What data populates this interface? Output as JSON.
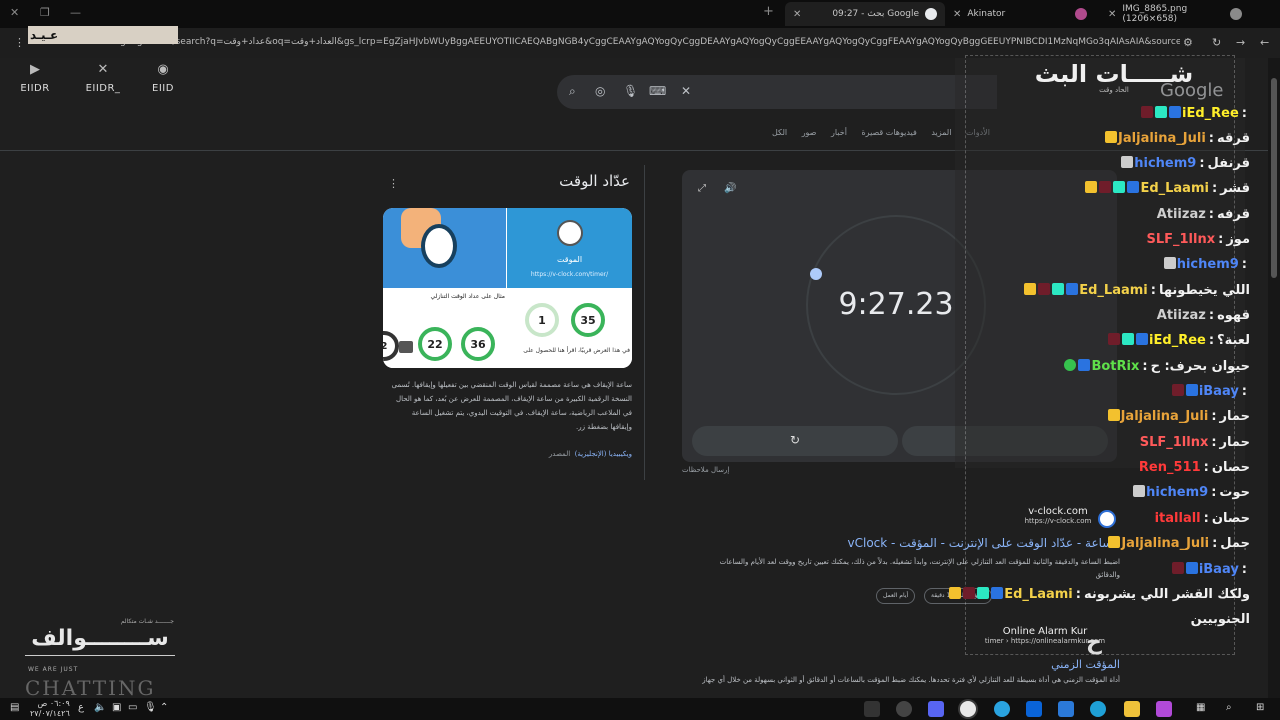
{
  "browser": {
    "tabs": [
      {
        "label": "IMG_8865.png (1206×658)",
        "fav_color": "#8a8a8a",
        "active": false
      },
      {
        "label": "Akinator",
        "fav_color": "#b04a8c",
        "active": false
      },
      {
        "label": "09:27 - بحث Google",
        "fav_color": "#e8eaed",
        "active": true
      }
    ],
    "new_tab": "+",
    "url": "google.com/search?q=عداد+وقت&oq=العداد+وقت&gs_lcrp=EgZjaHJvbWUyBggAEEUYOTIICAEQABgNGB4yCggCEAAYgAQYogQyCggDEAAYgAQYogQyCggEEAAYgAQYogQyCggFEAAYgAQYogQyBggGEEUYPNIBCDI1MzNqMGo3qAIAsAIA&sourceid=chrome"
  },
  "overlay_top_left_logo": "عـيـد",
  "socials": [
    {
      "icon": "youtube-icon",
      "glyph": "▶",
      "label": "EIIDR"
    },
    {
      "icon": "x-icon",
      "glyph": "✕",
      "label": "EIIDR_"
    },
    {
      "icon": "discord-icon",
      "glyph": "◉",
      "label": "EIID"
    }
  ],
  "google": {
    "logo": "Google",
    "nav_tabs": [
      "الأدوات",
      "المزيد",
      "فيديوهات قصيرة",
      "أخبار",
      "صور",
      "الكل"
    ]
  },
  "knowledge_panel": {
    "title": "عدّاد الوقت",
    "image_card_right": {
      "title": "الموقت",
      "url": "https://v-clock.com/timer/"
    },
    "image_card_article": "مثال على عداد الوقت التنازلي",
    "image_card_caption": "في هذا العرض قريبًا، اقرأ هنا للحصول على",
    "rings": [
      "35",
      "1",
      "36",
      "22",
      "2"
    ],
    "description": "ساعة الإيقاف هي ساعة مصممة لقياس الوقت المنقضي بين تفعيلها وإيقافها. تُسمى النسخة الرقمية الكبيرة من ساعة الإيقاف، المصممة للعرض عن بُعد، كما هو الحال في الملاعب الرياضية، ساعة الإيقاف. في التوقيت اليدوي، يتم تشغيل الساعة وإيقافها بضغطة زر.",
    "source_label": "المصدر",
    "source_link": "ويكيبيديا (الإنجليزية)"
  },
  "timer": {
    "display": "9:27.23",
    "reset_label": "↻",
    "feedback": "إرسال ملاحظات"
  },
  "results": [
    {
      "title": "vClock - الساعة - عدّاد الوقت على الإنترنت - المؤقت",
      "snippet": "اضبط الساعة والدقيقة والثانية للمؤقت العد التنازلي على الإنترنت، وابدأ تشغيله. بدلاً من ذلك، يمكنك تعيين تاريخ ووقت لعد الأيام والساعات والدقائق",
      "chips": [
        "أيام العمل",
        "المؤقت لمدة 1 دقيقة"
      ]
    },
    {
      "title": "المؤقت الزمني",
      "snippet": "أداة المؤقت الزمني هي أداة بسيطة للعد التنازلي لأي فترة تحددها. يمكنك ضبط المؤقت بالساعات أو الدقائق أو الثواني بسهولة من خلال أي جهاز"
    }
  ],
  "chat": {
    "title": "شـــــات البث",
    "subtitle": "الحاد وقت",
    "messages": [
      {
        "user": "iEd_Ree",
        "color": "#ffef2a",
        "badges": [
          "mod",
          "vip",
          "sub"
        ],
        "msg": ""
      },
      {
        "user": "Jaljalina_Juli",
        "color": "#e8a33a",
        "badges": [
          "crown"
        ],
        "msg": "قرقه"
      },
      {
        "user": "hichem9",
        "color": "#4f86f7",
        "badges": [
          "sword"
        ],
        "msg": "قرنفل"
      },
      {
        "user": "Ed_Laami",
        "color": "#f3d14a",
        "badges": [
          "mod",
          "vip",
          "sub",
          "crown"
        ],
        "msg": "قشر"
      },
      {
        "user": "Atiizaz",
        "color": "#cfcfcf",
        "badges": [],
        "msg": "قرفه"
      },
      {
        "user": "SLF_1llnx",
        "color": "#ff5a5a",
        "badges": [],
        "msg": "موز"
      },
      {
        "user": "hichem9",
        "color": "#4f86f7",
        "badges": [
          "sword"
        ],
        "msg": ""
      },
      {
        "user": "Ed_Laami",
        "color": "#f3d14a",
        "badges": [
          "mod",
          "vip",
          "sub",
          "crown"
        ],
        "msg": "اللي يخيطونها"
      },
      {
        "user": "Atiizaz",
        "color": "#cfcfcf",
        "badges": [],
        "msg": "قهوه"
      },
      {
        "user": "iEd_Ree",
        "color": "#ffef2a",
        "badges": [
          "mod",
          "vip",
          "sub"
        ],
        "msg": "لعبة؟"
      },
      {
        "user": "BotRix",
        "color": "#5fe04a",
        "badges": [
          "mod",
          "verified"
        ],
        "msg": "حيوان بحرف: ح"
      },
      {
        "user": "iBaay",
        "color": "#4f86f7",
        "badges": [
          "mod",
          "sub"
        ],
        "msg": ""
      },
      {
        "user": "Jaljalina_Juli",
        "color": "#e8a33a",
        "badges": [
          "crown"
        ],
        "msg": "حمار"
      },
      {
        "user": "SLF_1llnx",
        "color": "#ff5a5a",
        "badges": [],
        "msg": "حمار"
      },
      {
        "user": "Ren_511",
        "color": "#ff3a3a",
        "badges": [],
        "msg": "حصان"
      },
      {
        "user": "hichem9",
        "color": "#4f86f7",
        "badges": [
          "sword"
        ],
        "msg": "حوت"
      },
      {
        "user": "itallall",
        "color": "#ff3a3a",
        "badges": [],
        "msg": "حصان"
      },
      {
        "user": "Jaljalina_Juli",
        "color": "#e8a33a",
        "badges": [
          "crown"
        ],
        "msg": "جمل"
      },
      {
        "user": "iBaay",
        "color": "#4f86f7",
        "badges": [
          "mod",
          "sub"
        ],
        "msg": ""
      },
      {
        "user": "Ed_Laami",
        "color": "#f3d14a",
        "badges": [
          "mod",
          "vip",
          "sub",
          "crown"
        ],
        "msg": "ولكك القشر اللي يشربونه"
      }
    ],
    "wrap_line": "الجنوبيين"
  },
  "overlays": {
    "vclock_name": "v-clock.com",
    "vclock_sub": "https://v-clock.com",
    "onlinealarm_name": "Online Alarm Kur",
    "onlinealarm_sub": "timer › https://onlinealarmkur.com"
  },
  "brand": {
    "top": "جـــــــد شـات متكالم",
    "main": "ســــــــوالف",
    "sub": "WE ARE JUST",
    "chatting": "CHATTING"
  },
  "taskbar": {
    "time": "٠٦:٠٩ ص",
    "date": "٢٧/٠٧/١٤٢٦",
    "lang": "ع"
  },
  "colors": {
    "accent_link": "#8ab4f8",
    "page_bg": "#1f1f1f",
    "panel_bg": "#303134"
  }
}
